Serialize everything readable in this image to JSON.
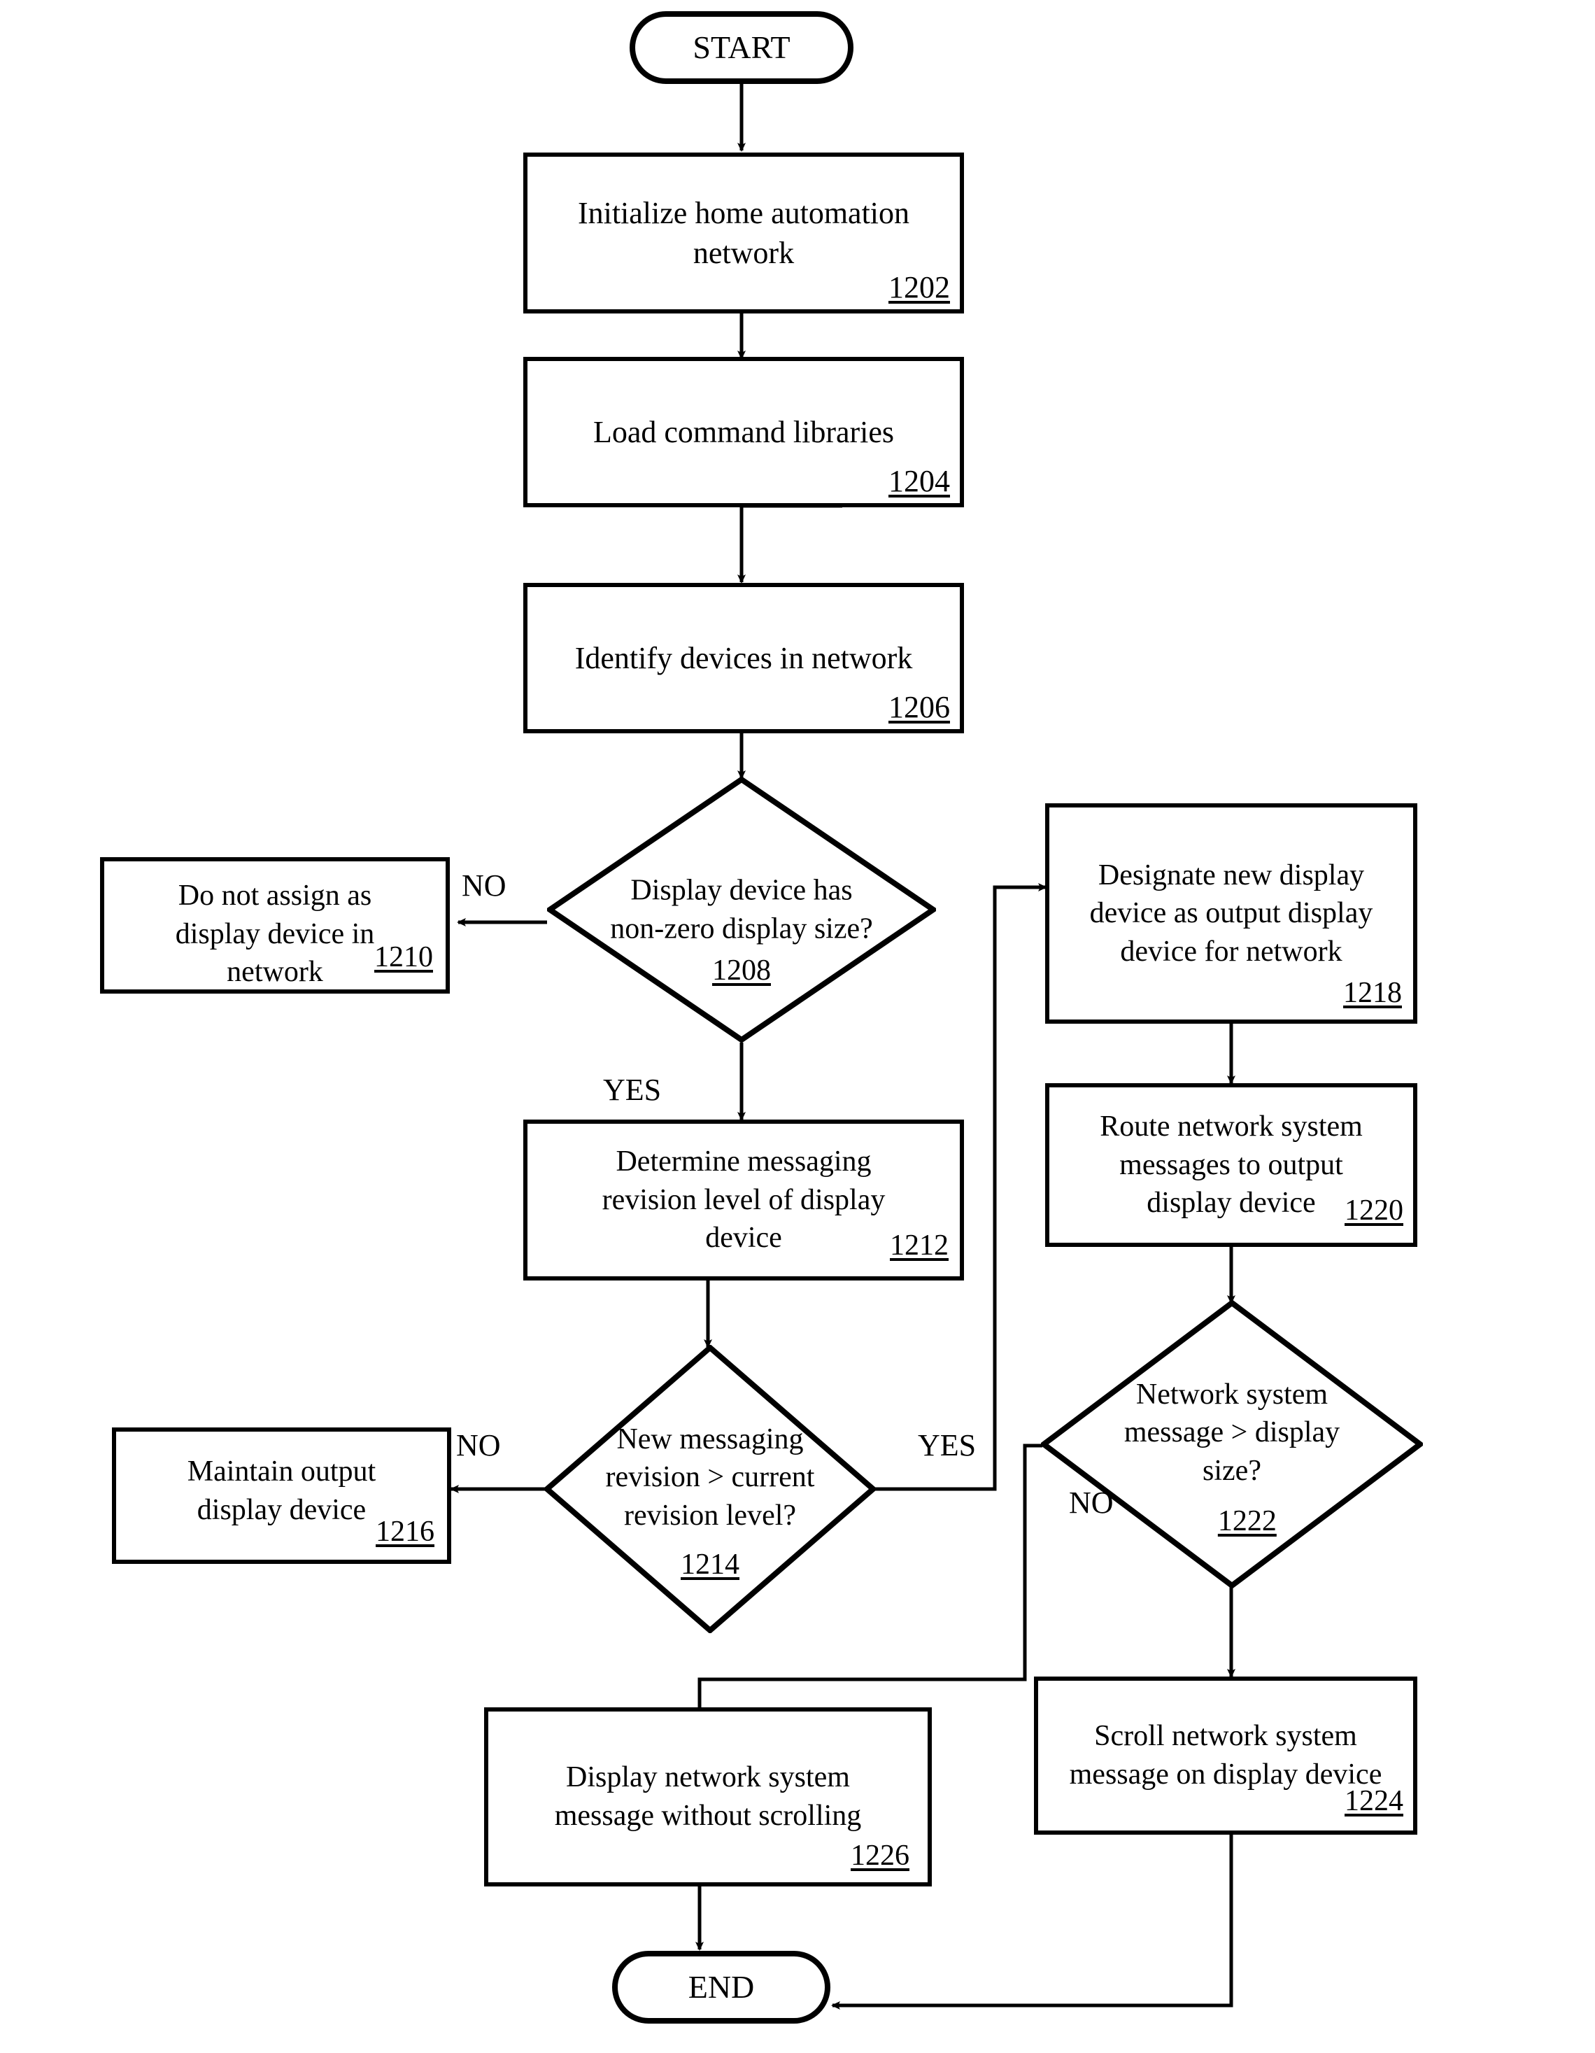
{
  "figure": {
    "type": "patent-flowchart",
    "nodes": {
      "start": {
        "label": "START",
        "shape": "terminator"
      },
      "end": {
        "label": "END",
        "shape": "terminator"
      },
      "n1202": {
        "text": "Initialize home automation\nnetwork",
        "ref": "1202",
        "shape": "process"
      },
      "n1204": {
        "text": "Load command libraries",
        "ref": "1204",
        "shape": "process"
      },
      "n1206": {
        "text": "Identify devices in network",
        "ref": "1206",
        "shape": "process"
      },
      "n1208": {
        "text": "Display device has\nnon-zero display size?",
        "ref": "1208",
        "shape": "decision"
      },
      "n1210": {
        "text": "Do not assign as\ndisplay device in\nnetwork",
        "ref": "1210",
        "shape": "process"
      },
      "n1212": {
        "text": "Determine messaging\nrevision level of display\ndevice",
        "ref": "1212",
        "shape": "process"
      },
      "n1214": {
        "text": "New messaging\nrevision > current\nrevision level?",
        "ref": "1214",
        "shape": "decision"
      },
      "n1216": {
        "text": "Maintain output\ndisplay device",
        "ref": "1216",
        "shape": "process"
      },
      "n1218": {
        "text": "Designate new display\ndevice as output display\ndevice for network",
        "ref": "1218",
        "shape": "process"
      },
      "n1220": {
        "text": "Route network system\nmessages to output\ndisplay device",
        "ref": "1220",
        "shape": "process"
      },
      "n1222": {
        "text": "Network system\nmessage > display\nsize?",
        "ref": "1222",
        "shape": "decision"
      },
      "n1224": {
        "text": "Scroll network system\nmessage on display device",
        "ref": "1224",
        "shape": "process"
      },
      "n1226": {
        "text": "Display network system\nmessage without scrolling",
        "ref": "1226",
        "shape": "process"
      }
    },
    "branch_labels": {
      "no_1208": "NO",
      "yes_1208": "YES",
      "no_1214": "NO",
      "yes_1214": "YES",
      "no_1222": "NO"
    },
    "colors": {
      "stroke": "#000000",
      "background": "#ffffff"
    }
  }
}
